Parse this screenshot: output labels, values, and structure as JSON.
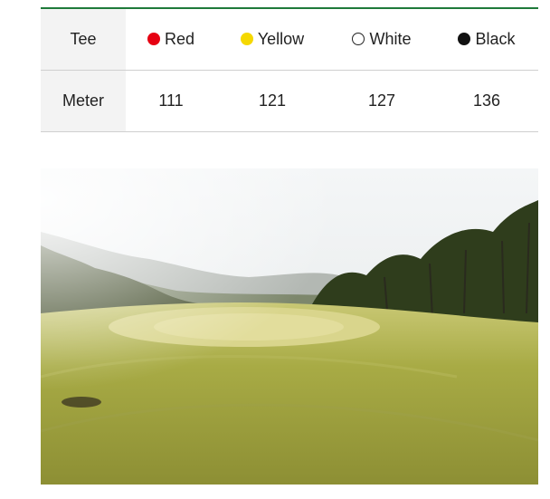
{
  "tees": {
    "row_label": "Tee",
    "items": [
      {
        "name": "Red",
        "color": "#e60012"
      },
      {
        "name": "Yellow",
        "color": "#f5d800"
      },
      {
        "name": "White",
        "color": "#ffffff"
      },
      {
        "name": "Black",
        "color": "#111111"
      }
    ]
  },
  "distances": {
    "row_label": "Meter",
    "values": [
      "111",
      "121",
      "127",
      "136"
    ]
  },
  "photo": {
    "subject": "golf-course-green-photo"
  }
}
